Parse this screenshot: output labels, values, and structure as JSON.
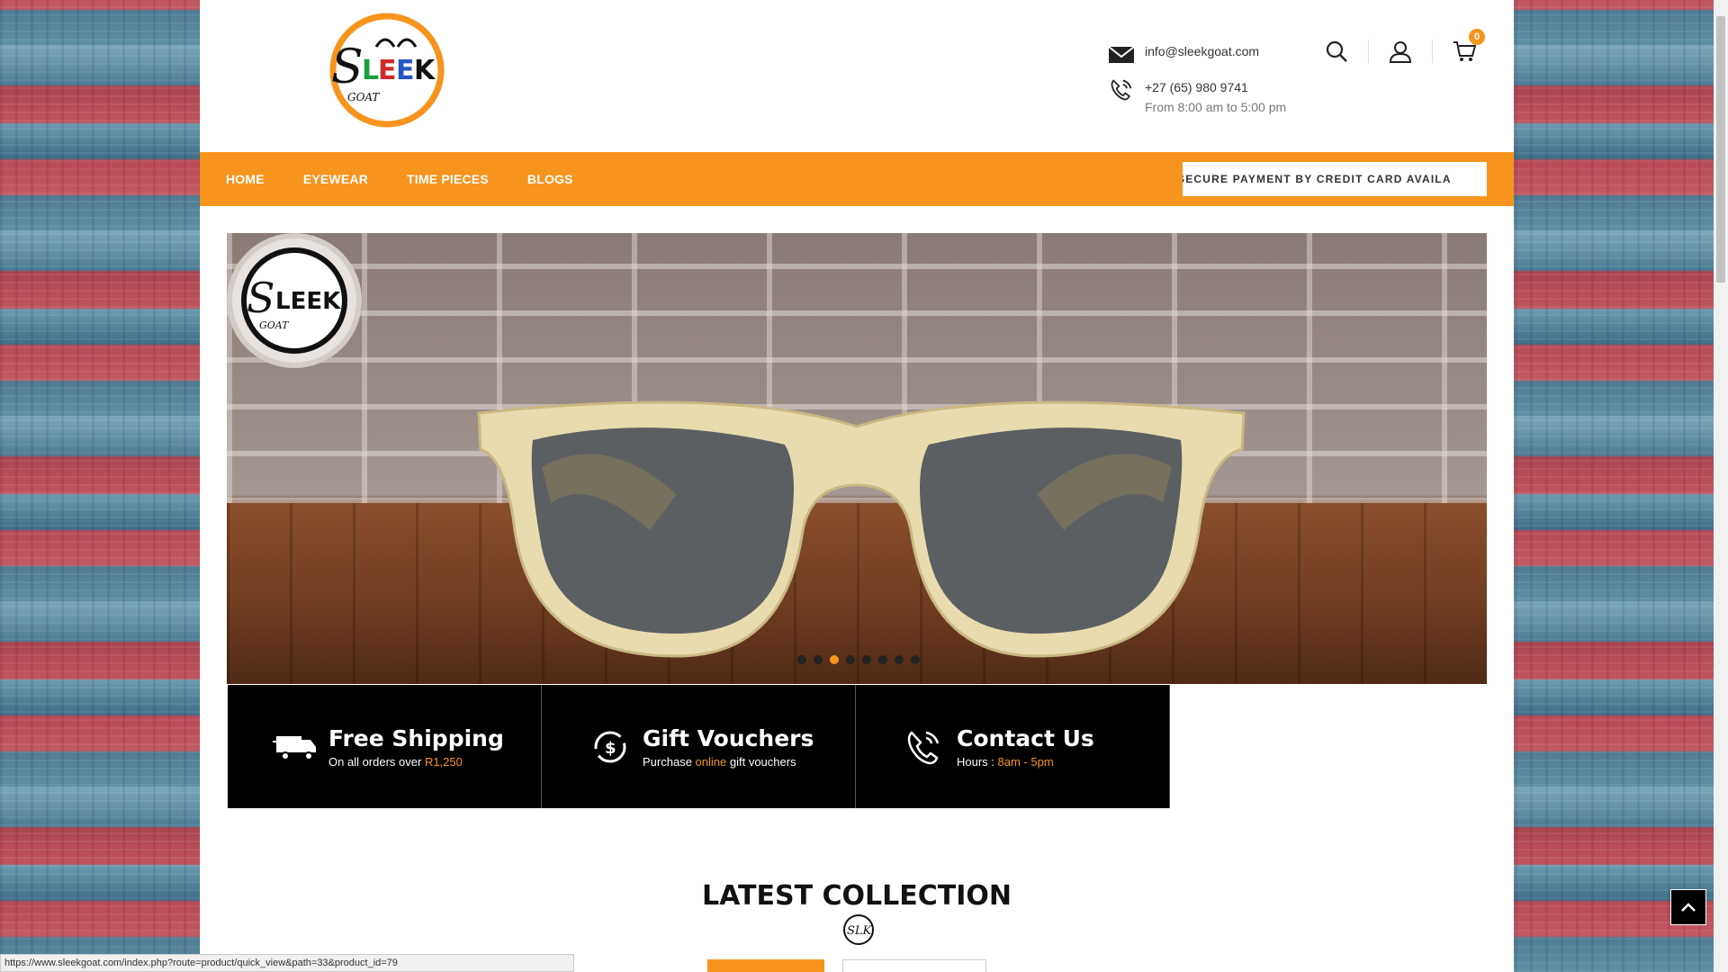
{
  "header": {
    "email": "info@sleekgoat.com",
    "phone": "+27 (65) 980 9741",
    "hours": "From 8:00 am to 5:00 pm",
    "cart_count": "0",
    "logo_text": "SLEEK GOAT"
  },
  "nav": {
    "items": [
      "HOME",
      "EYEWEAR",
      "TIME PIECES",
      "BLOGS"
    ],
    "marquee": "SECURE PAYMENT BY CREDIT CARD AVAILA"
  },
  "slider": {
    "dot_count": 8,
    "active_dot": 3
  },
  "features": [
    {
      "title": "Free Shipping",
      "text_before": "On all orders over ",
      "highlight": "R1,250",
      "text_after": "",
      "icon": "truck-icon"
    },
    {
      "title": "Gift Vouchers",
      "text_before": "Purchase ",
      "highlight": "online",
      "text_after": " gift vouchers",
      "icon": "dollar-cycle-icon"
    },
    {
      "title": "Contact Us",
      "text_before": "Hours : ",
      "highlight": "8am - 5pm",
      "text_after": "",
      "icon": "phone-icon"
    }
  ],
  "section": {
    "latest_title": "LATEST COLLECTION"
  },
  "status_bar": {
    "url": "https://www.sleekgoat.com/index.php?route=product/quick_view&path=33&product_id=79"
  },
  "colors": {
    "accent": "#f7941d",
    "dark": "#000000"
  }
}
